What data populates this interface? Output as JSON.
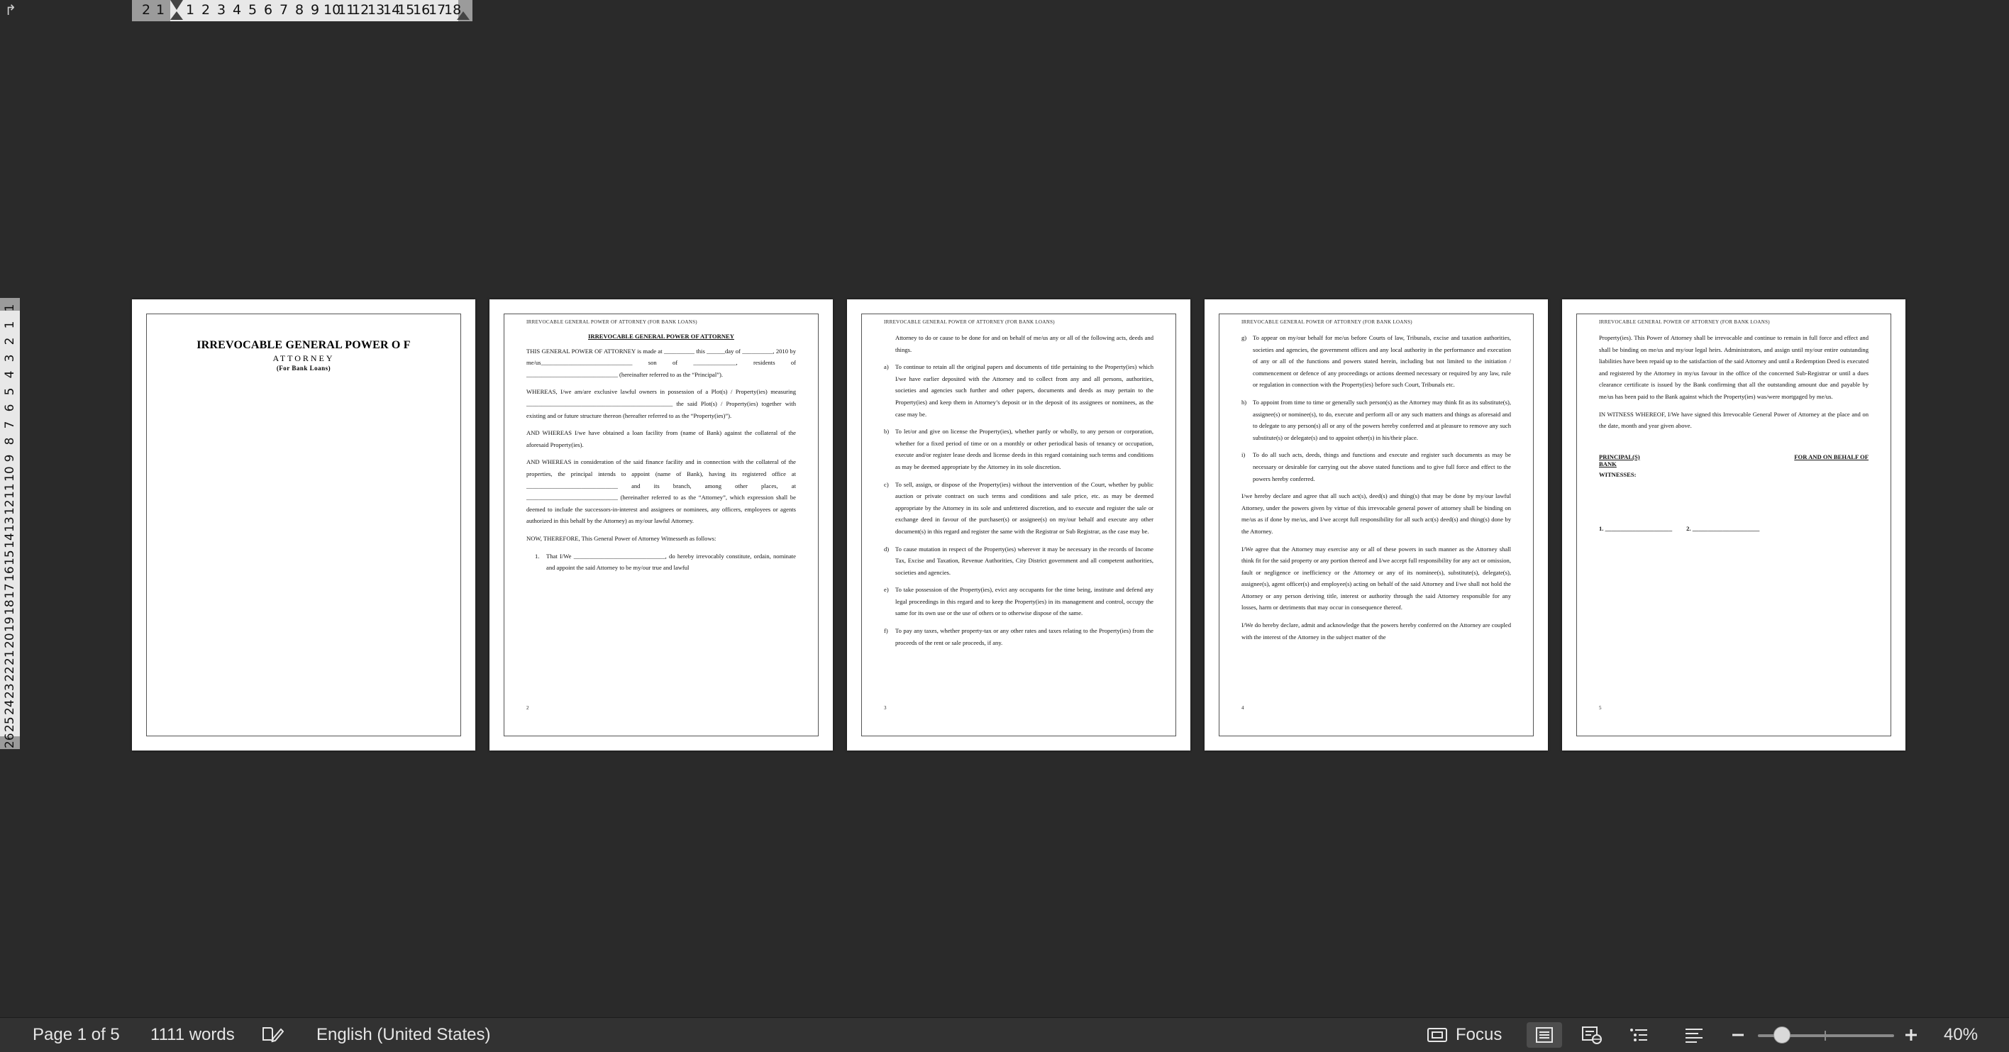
{
  "ruler": {
    "corner_icon": "tab-stop-icon",
    "h_labels": [
      "2",
      "1",
      "1",
      "2",
      "3",
      "4",
      "5",
      "6",
      "7",
      "8",
      "9",
      "10",
      "11",
      "12",
      "13",
      "14",
      "15",
      "16",
      "17",
      "18"
    ],
    "v_labels": [
      "1",
      "1",
      "2",
      "3",
      "4",
      "5",
      "6",
      "7",
      "8",
      "9",
      "10",
      "11",
      "12",
      "13",
      "14",
      "15",
      "16",
      "17",
      "18",
      "19",
      "20",
      "21",
      "22",
      "23",
      "24",
      "25",
      "26"
    ]
  },
  "doc": {
    "running_header": "IRREVOCABLE GENERAL POWER OF ATTORNEY (FOR BANK LOANS)",
    "page1": {
      "title_line1": "IRREVOCABLE GENERAL POWER O F",
      "title_line2": "ATTORNEY",
      "title_line3": "(For Bank Loans)"
    },
    "page2": {
      "heading": "IRREVOCABLE GENERAL POWER OF ATTORNEY",
      "p1": "THIS GENERAL POWER OF ATTORNEY is made at __________ this ______day of __________, 2010 by me/us______________________________ son of ______________, residents of ______________________________ (hereinafter referred to as the “Principal”).",
      "p2": "WHEREAS, I/we am/are exclusive lawful owners in possession of a Plot(s) / Property(ies) measuring ________________________________________________ the said Plot(s) / Property(ies) together with existing and or future structure thereon (hereafter referred to as the “Property(ies)”).",
      "p3": "AND WHEREAS I/we have obtained a loan facility from (name of Bank) against the collateral of the aforesaid Property(ies).",
      "p4": "AND WHEREAS in consideration of the said finance facility and in connection with the collateral of the properties, the principal intends to appoint (name of Bank), having its registered office at ______________________________ and its branch, among other places, at ______________________________ (hereinafter referred to as the “Attorney”, which expression shall be deemed to include the successors-in-interest and assignees or nominees, any officers, employees or agents authorized in this behalf by the Attorney) as my/our lawful Attorney.",
      "p5": "NOW, THEREFORE, This General Power of Attorney Witnesseth as follows:",
      "item1_key": "1.",
      "item1": "That I/We ______________________________, do hereby irrevocably constitute, ordain, nominate and appoint the said Attorney to be my/our true and lawful",
      "page_number": "2"
    },
    "page3": {
      "intro": "Attorney to do or cause to be done for and on behalf of me/us any or all of the following acts, deeds and things.",
      "items": [
        {
          "key": "a)",
          "text": "To continue to retain all the original papers and documents of title pertaining to the Property(ies) which I/we have earlier deposited with the Attorney and to collect from any and all persons, authorities, societies and agencies such further and other papers, documents and deeds as may pertain to the Property(ies) and keep them in Attorney’s deposit or in the deposit of its assignees or nominees, as the case may be."
        },
        {
          "key": "b)",
          "text": "To let/or and give on license the Property(ies), whether partly or wholly, to any person or corporation, whether for a fixed period of time or on a monthly or other periodical basis of tenancy or occupation, execute and/or register lease deeds and license deeds in this regard containing such terms and conditions as may be deemed appropriate by the Attorney in its sole discretion."
        },
        {
          "key": "c)",
          "text": "To sell, assign, or dispose of the Property(ies) without the intervention of the Court, whether by public auction or private contract on such terms and conditions and sale price, etc. as may be deemed appropriate by the Attorney in its sole and unfettered discretion, and to execute and register the sale or exchange deed in favour of the purchaser(s) or assignee(s) on my/our behalf and execute any other document(s) in this regard and register the same with the Registrar or Sub Registrar, as the case may be."
        },
        {
          "key": "d)",
          "text": "To cause mutation in respect of the Property(ies) wherever it may be necessary in the records of Income Tax, Excise and Taxation, Revenue Authorities, City District government and all competent authorities, societies and agencies."
        },
        {
          "key": "e)",
          "text": "To take possession of the Property(ies), evict any occupants for the time being, institute and defend any legal proceedings in this regard and to keep the Property(ies) in its management and control, occupy the same for its own use or the use of others or to otherwise dispose of the same."
        },
        {
          "key": "f)",
          "text": "To pay any taxes, whether property-tax or any other rates and taxes relating to the Property(ies) from the proceeds of the rent or sale proceeds, if any."
        }
      ],
      "page_number": "3"
    },
    "page4": {
      "items": [
        {
          "key": "g)",
          "text": "To appear on my/our behalf for me/us before Courts of law, Tribunals, excise and taxation authorities, societies and agencies, the government offices and any local authority in the performance and execution of any or all of the functions and powers stated herein, including but not limited to the initiation / commencement or defence of any proceedings or actions deemed necessary or required by any law, rule or regulation in connection with the Property(ies) before such Court, Tribunals etc."
        },
        {
          "key": "h)",
          "text": "To appoint from time to time or generally such person(s) as the Attorney may think fit as its substitute(s), assignee(s) or nominee(s), to do, execute and perform all or any such matters and things as aforesaid and to delegate to any person(s) all or any of the powers hereby conferred and at pleasure to remove any such substitute(s) or delegate(s) and to appoint other(s) in his/their place."
        },
        {
          "key": "i)",
          "text": "To do all such acts, deeds, things and functions and execute and register such documents as may be necessary or desirable for carrying out the above stated functions and to give full force and effect to the powers hereby conferred."
        }
      ],
      "p1": "I/we hereby declare and agree that all such act(s), deed(s) and thing(s) that may be done by my/our lawful Attorney, under the powers given by virtue of this irrevocable general power of attorney shall be binding on me/us as if done by me/us, and I/we accept full responsibility for all such act(s) deed(s) and thing(s) done by the Attorney.",
      "p2": "I/We agree that the Attorney may exercise any or all of these powers in such manner as the Attorney shall think fit for the said property or any portion thereof and I/we accept full responsibility for any act or omission, fault or negligence or inefficiency or the Attorney or any of its nominee(s), substitute(s), delegate(s), assignee(s), agent officer(s) and employee(s) acting on behalf of the said Attorney and I/we shall not hold the Attorney or any person deriving title, interest or authority through the said Attorney responsible for any losses, harm or detriments that may occur in consequence thereof.",
      "p3": "I/We do hereby declare, admit and acknowledge that the powers hereby conferred on the Attorney are coupled with the interest of the Attorney in the subject matter of the",
      "page_number": "4"
    },
    "page5": {
      "p1": "Property(ies). This Power of Attorney shall be irrevocable and continue to remain in full force and effect and shall be binding on me/us and my/our legal heirs. Administrators, and assign until my/our entire outstanding liabilities have been repaid up to the satisfaction of the said Attorney and until a Redemption Deed is executed and registered by the Attorney in my/us favour in the office of the concerned Sub-Registrar or until a dues clearance certificate is issued by the Bank confirming that all the outstanding amount due and payable by me/us has been paid to the Bank against which the Property(ies) was/were mortgaged by me/us.",
      "p2": "IN WITNESS WHEREOF, I/We have signed this Irrevocable General Power of Attorney at the place and on the date, month and year given above.",
      "principal": "PRINCIPAL(S)",
      "bank": "BANK",
      "behalf": "FOR AND ON BEHALF OF",
      "witnesses": "WITNESSES:",
      "w1": "1. ______________________",
      "w2": "2. ______________________",
      "page_number": "5"
    }
  },
  "status": {
    "page_indicator": "Page 1 of 5",
    "word_count": "1111 words",
    "proofing_icon": "proofing-icon",
    "language": "English (United States)",
    "focus_label": "Focus",
    "focus_icon": "focus-icon",
    "zoom_level": "40%",
    "zoom_fraction": 0.4
  }
}
